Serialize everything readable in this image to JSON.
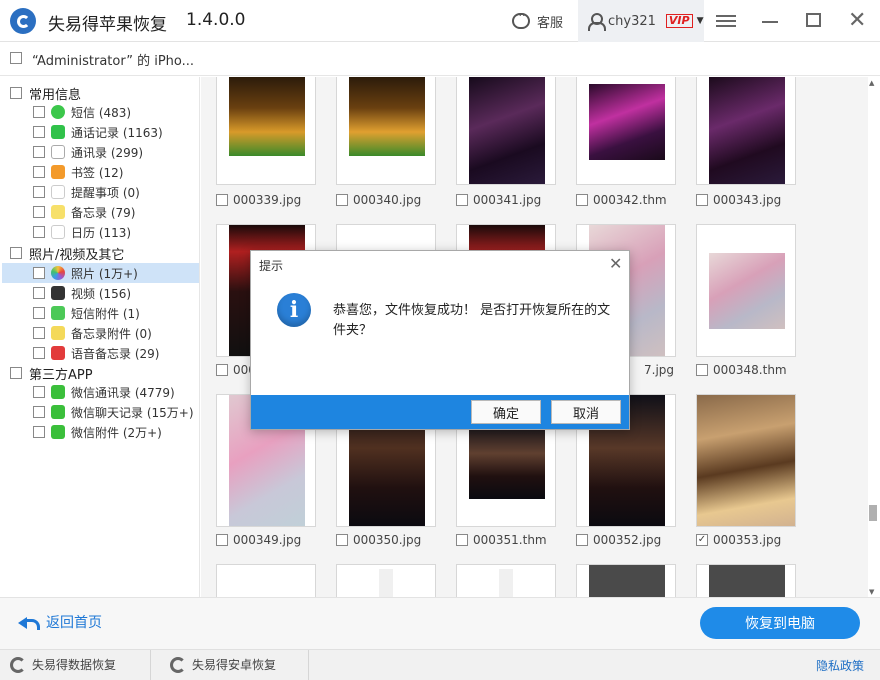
{
  "app": {
    "title": "失易得苹果恢复",
    "version": "1.4.0.0"
  },
  "titlebar": {
    "service_label": "客服",
    "username": "chy321",
    "vip_label": "VIP"
  },
  "device": {
    "name": "“Administrator” 的 iPho..."
  },
  "sidebar": {
    "categories": [
      {
        "label": "常用信息",
        "items": [
          {
            "label": "短信 (483)",
            "icon": "message-icon"
          },
          {
            "label": "通话记录 (1163)",
            "icon": "phone-icon"
          },
          {
            "label": "通讯录 (299)",
            "icon": "contacts-icon"
          },
          {
            "label": "书签 (12)",
            "icon": "bookmark-icon"
          },
          {
            "label": "提醒事项 (0)",
            "icon": "reminder-icon"
          },
          {
            "label": "备忘录 (79)",
            "icon": "notes-icon"
          },
          {
            "label": "日历 (113)",
            "icon": "calendar-icon"
          }
        ]
      },
      {
        "label": "照片/视频及其它",
        "items": [
          {
            "label": "照片 (1万+)",
            "icon": "photos-icon"
          },
          {
            "label": "视频 (156)",
            "icon": "video-icon"
          },
          {
            "label": "短信附件 (1)",
            "icon": "attachment-icon"
          },
          {
            "label": "备忘录附件 (0)",
            "icon": "notes-attachment-icon"
          },
          {
            "label": "语音备忘录 (29)",
            "icon": "voice-memo-icon"
          }
        ]
      },
      {
        "label": "第三方APP",
        "items": [
          {
            "label": "微信通讯录 (4779)",
            "icon": "wechat-icon"
          },
          {
            "label": "微信聊天记录 (15万+)",
            "icon": "wechat-icon"
          },
          {
            "label": "微信附件 (2万+)",
            "icon": "wechat-icon"
          }
        ]
      }
    ]
  },
  "files": [
    [
      "000339.jpg",
      "000340.jpg",
      "000341.jpg",
      "000342.thm",
      "000343.jpg"
    ],
    [
      "",
      "",
      "",
      "",
      "000348.thm"
    ],
    [
      "000349.jpg",
      "000350.jpg",
      "000351.thm",
      "000352.jpg",
      "000353.jpg"
    ]
  ],
  "row2_partial": {
    "col1": "000",
    "col4": "7.jpg"
  },
  "checked_file": "000353.jpg",
  "footer": {
    "back_label": "返回首页",
    "recover_label": "恢复到电脑"
  },
  "bottombar": {
    "data_recovery": "失易得数据恢复",
    "android_recovery": "失易得安卓恢复",
    "privacy": "隐私政策"
  },
  "dialog": {
    "title": "提示",
    "message": "恭喜您，文件恢复成功！ 是否打开恢复所在的文件夹？",
    "ok_label": "确定",
    "cancel_label": "取消"
  },
  "colors": {
    "accent": "#1f8be8",
    "dialog_bar": "#1e85e0",
    "selected_row": "#cfe3f8"
  }
}
